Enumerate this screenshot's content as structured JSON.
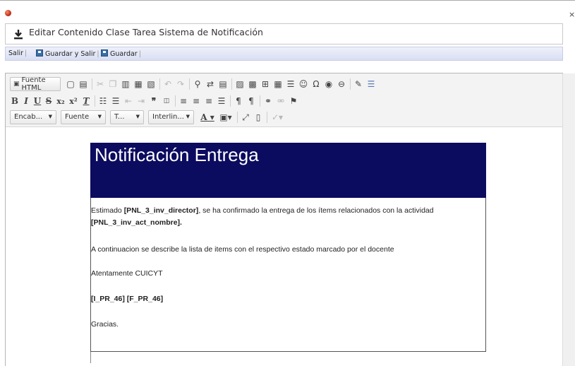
{
  "window": {
    "close_glyph": "×"
  },
  "header": {
    "title": "Editar Contenido Clase Tarea Sistema de Notificación",
    "icon": "download-icon"
  },
  "actions": {
    "exit": "Salir",
    "save_exit": "Guardar y Salir",
    "save": "Guardar"
  },
  "toolbar": {
    "source_label": "Fuente HTML",
    "combos": {
      "format": "Encab...",
      "font": "Fuente",
      "size": "T...",
      "line_height": "Interlin..."
    }
  },
  "document": {
    "banner_title": "Notificación Entrega",
    "greeting": {
      "prefix": "Estimado ",
      "director_token": "[PNL_3_inv_director]",
      "middle": ", se ha confirmado la entrega de los ítems relacionados con la actividad",
      "activity_token": "[PNL_3_inv_act_nombre]."
    },
    "list_intro": "A continuacion se describe la lista de items con el respectivo estado marcado por el docente",
    "signature": "Atentamente CUICYT",
    "tokens_line": "[I_PR_46] [F_PR_46]",
    "closing": "Gracias."
  }
}
